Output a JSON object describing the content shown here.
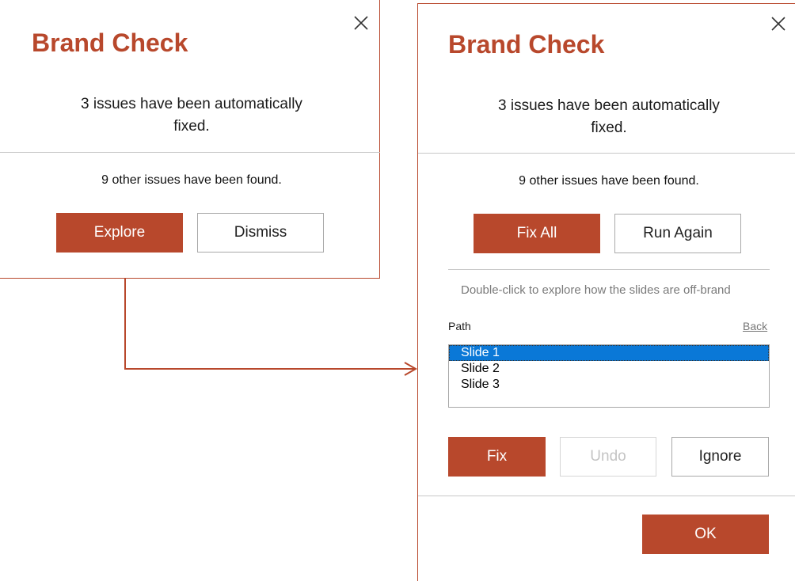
{
  "colors": {
    "accent": "#b8482c",
    "selection": "#0a78d7"
  },
  "dialog_initial": {
    "title": "Brand Check",
    "auto_fixed_line1": "3 issues have been automatically",
    "auto_fixed_line2": "fixed.",
    "found_text": "9 other issues have been found.",
    "explore_label": "Explore",
    "dismiss_label": "Dismiss",
    "close_icon": "close-icon"
  },
  "dialog_explore": {
    "title": "Brand Check",
    "auto_fixed_line1": "3 issues have been automatically",
    "auto_fixed_line2": "fixed.",
    "found_text": "9 other issues have been found.",
    "fix_all_label": "Fix All",
    "run_again_label": "Run Again",
    "hint": "Double-click to explore how the slides are off-brand",
    "path_label": "Path",
    "back_label": "Back",
    "slides": [
      {
        "label": "Slide 1",
        "selected": true
      },
      {
        "label": "Slide 2",
        "selected": false
      },
      {
        "label": "Slide 3",
        "selected": false
      }
    ],
    "fix_label": "Fix",
    "undo_label": "Undo",
    "ignore_label": "Ignore",
    "ok_label": "OK",
    "close_icon": "close-icon"
  }
}
